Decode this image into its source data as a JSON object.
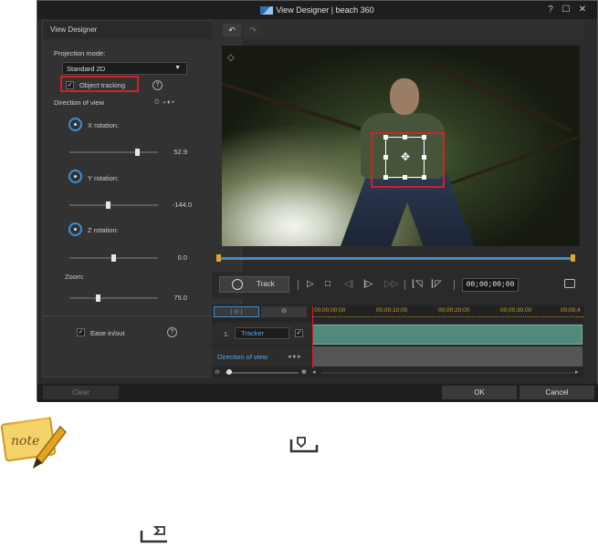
{
  "window": {
    "title": "View Designer",
    "project": "beach 360",
    "separator": "|",
    "help": "?",
    "maximize": "☐",
    "close": "✕"
  },
  "left_panel": {
    "header": "View Designer",
    "projection_label": "Projection mode:",
    "projection_value": "Standard 2D",
    "object_tracking_label": "Object tracking",
    "object_tracking_checked": true,
    "direction_label": "Direction of view",
    "x_rotation_label": "X rotation:",
    "x_rotation_value": "52.9",
    "y_rotation_label": "Y rotation:",
    "y_rotation_value": "-144.0",
    "z_rotation_label": "Z rotation:",
    "z_rotation_value": "0.0",
    "zoom_label": "Zoom:",
    "zoom_value": "75.0",
    "ease_label": "Ease in/out",
    "ease_checked": true
  },
  "toolbar": {
    "undo": "↶",
    "redo": "↷"
  },
  "transport": {
    "track_label": "Track",
    "timecode": "00;00;00;00"
  },
  "timeline": {
    "ruler": [
      "00;00;00;00",
      "00;00;10;00",
      "00;00;20;00",
      "00;00;30;00",
      "00;00;4"
    ],
    "row1_index": "1.",
    "tracker_label": "Tracker",
    "row2_label": "Direction of view"
  },
  "buttons": {
    "clear": "Clear",
    "ok": "OK",
    "cancel": "Cancel"
  },
  "colors": {
    "highlight": "#d81f26",
    "accent": "#3f8bc6",
    "clip": "#4f8a7c"
  }
}
